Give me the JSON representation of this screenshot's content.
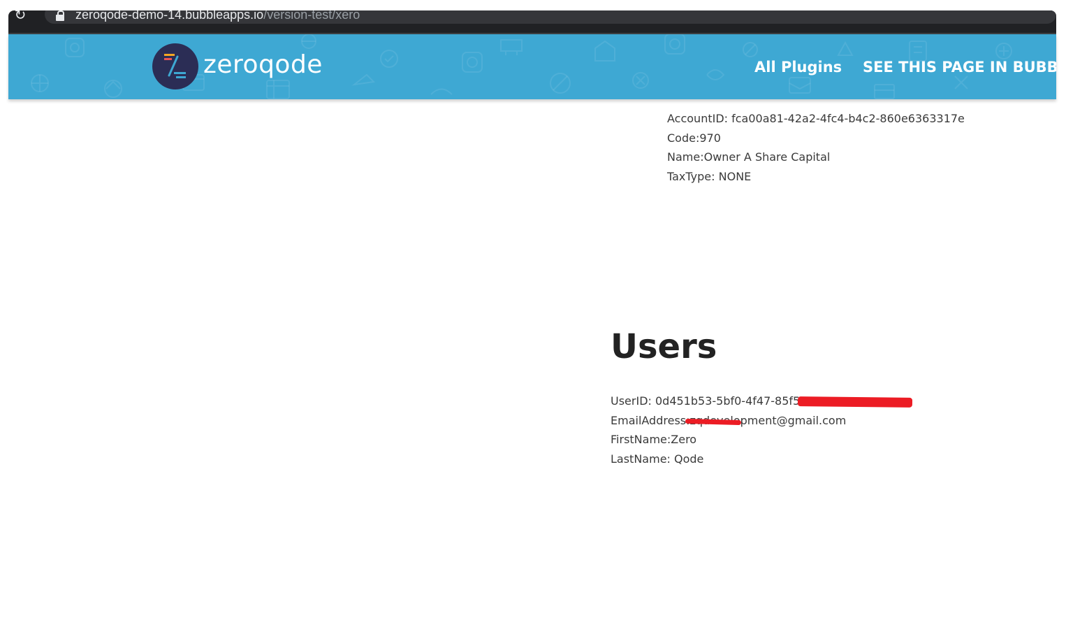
{
  "browser": {
    "url_host": "zeroqode-demo-14.bubbleapps.io",
    "url_path": "/version-test/xero"
  },
  "header": {
    "logo_text": "zeroqode",
    "nav": {
      "all_plugins": "All Plugins",
      "see_page": "SEE THIS PAGE IN BUBBLE E"
    },
    "colors": {
      "bar": "#3ea8d3",
      "logo_circle": "#2b2d55"
    }
  },
  "account": {
    "account_id": "AccountID: fca00a81-42a2-4fc4-b4c2-860e6363317e",
    "code": "Code:970",
    "name": "Name:Owner A Share Capital",
    "tax_type": "TaxType: NONE"
  },
  "users": {
    "title": "Users",
    "user_id": "UserID: 0d451b53-5bf0-4f47-85f5-",
    "email": "EmailAddress:zqdevelopment@gmail.com",
    "first_name": "FirstName:Zero",
    "last_name": "LastName: Qode"
  },
  "redaction_color": "#ec1c24"
}
